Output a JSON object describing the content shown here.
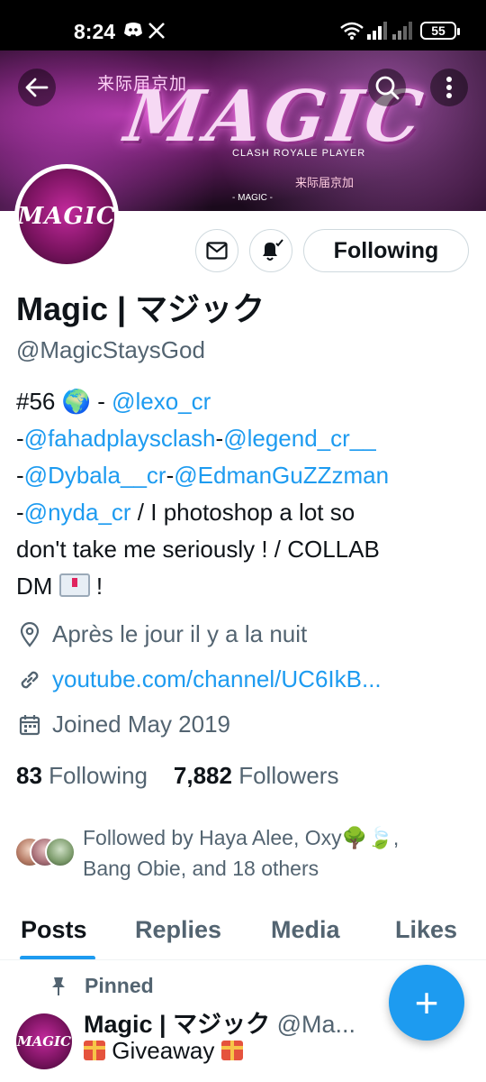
{
  "status_bar": {
    "time": "8:24",
    "battery": "55"
  },
  "banner": {
    "logo_text": "MAGIC",
    "chinese_top": "来际届京加",
    "subtitle": "CLASH ROYALE PLAYER",
    "chinese_bottom": "来际届京加",
    "tag": "- MAGIC -"
  },
  "avatar": {
    "text": "MAGIC"
  },
  "actions": {
    "following_label": "Following"
  },
  "profile": {
    "name": "Magic | マジック",
    "handle": "@MagicStaysGod",
    "bio": {
      "line1_prefix": "#56 🌍 - ",
      "mention1": "@lexo_cr",
      "dash1": "-",
      "mention2": "@fahadplaysclash",
      "dash2": "-",
      "mention3": "@legend_cr__",
      "dash3": "-",
      "mention4": "@Dybala__cr",
      "dash4": "-",
      "mention5": "@EdmanGuZZzman",
      "dash5": "-",
      "mention6": "@nyda_cr",
      "text1": " / I photoshop a lot so",
      "text2": "don't take me seriously ! / COLLAB",
      "text3_prefix": "DM ",
      "text3_suffix": " !"
    },
    "location": "Après le jour il y a la nuit",
    "website": "youtube.com/channel/UC6IkB...",
    "joined": "Joined May 2019",
    "following_count": "83",
    "following_label": "Following",
    "followers_count": "7,882",
    "followers_label": "Followers",
    "followed_by_line1": "Followed by Haya Alee, Oxy🌳🍃,",
    "followed_by_line2": "Bang Obie, and 18 others"
  },
  "tabs": [
    "Posts",
    "Replies",
    "Media",
    "Likes"
  ],
  "pinned_post": {
    "pinned_label": "Pinned",
    "author_name": "Magic | マジック",
    "author_handle": "@Ma...",
    "text": "Giveaway",
    "more": "·"
  },
  "fab": {
    "label": "+"
  },
  "colors": {
    "accent": "#1d9bf0",
    "text": "#0f1419",
    "muted": "#536471"
  }
}
